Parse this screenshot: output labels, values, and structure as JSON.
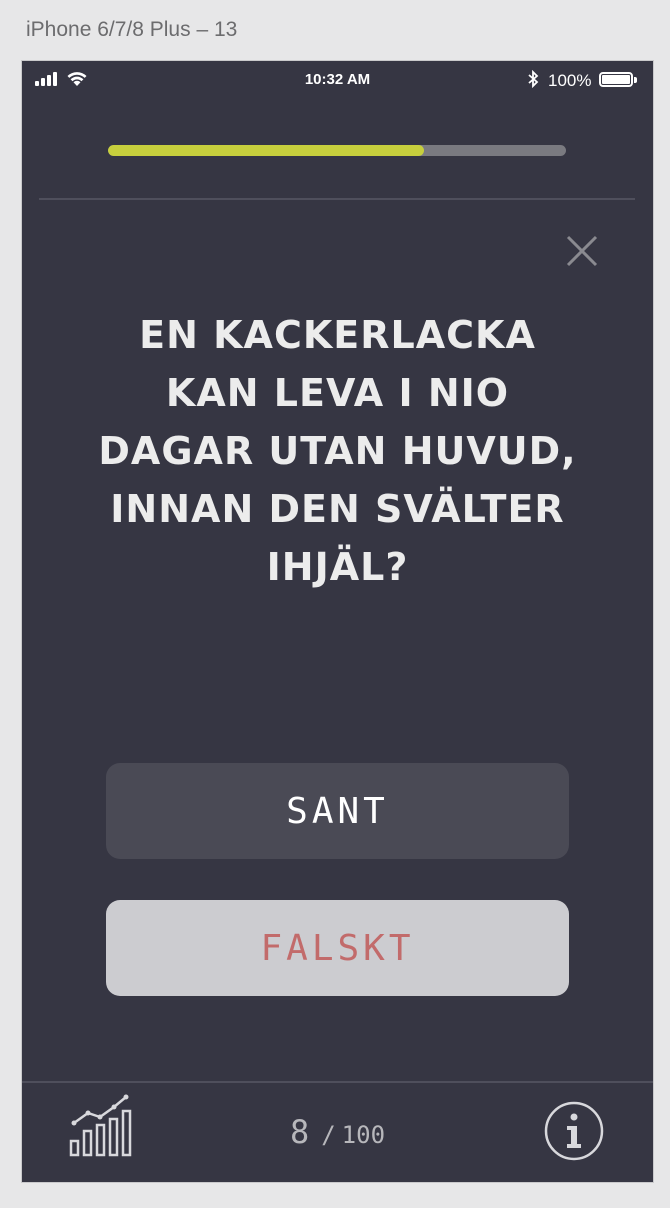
{
  "artboard": {
    "label": "iPhone 6/7/8 Plus – 13"
  },
  "status_bar": {
    "time": "10:32 AM",
    "battery": "100%"
  },
  "progress": {
    "fraction": 0.69
  },
  "icons": {
    "close": "close-icon",
    "stats": "bar-chart-icon",
    "info": "info-icon"
  },
  "question": {
    "text": "EN KACKERLACKA KAN LEVA I NIO DAGAR UTAN HUVUD, INNAN DEN SVÄLTER IHJÄL?"
  },
  "answers": {
    "true_label": "SANT",
    "false_label": "FALSKT"
  },
  "counter": {
    "current": "8",
    "separator": "/",
    "total": "100"
  },
  "colors": {
    "background": "#363643",
    "accent": "#c7cf3d",
    "true_button": "#4a4a55",
    "false_button": "#ccccd0",
    "false_text": "#c26b6b"
  }
}
